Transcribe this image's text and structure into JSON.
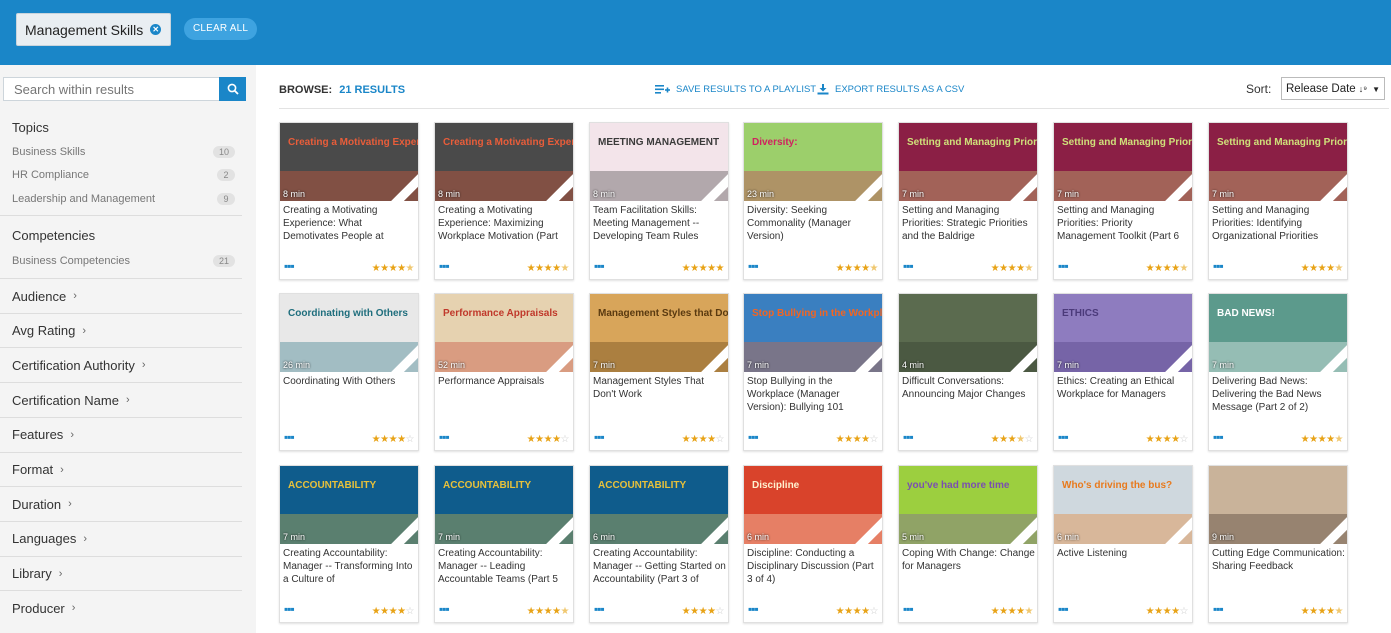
{
  "filter_chip": {
    "label": "Management Skills"
  },
  "clear_all": "CLEAR ALL",
  "search": {
    "placeholder": "Search within results"
  },
  "topics": {
    "title": "Topics",
    "items": [
      {
        "label": "Business Skills",
        "count": "10"
      },
      {
        "label": "HR Compliance",
        "count": "2"
      },
      {
        "label": "Leadership and Management",
        "count": "9"
      }
    ]
  },
  "competencies": {
    "title": "Competencies",
    "items": [
      {
        "label": "Business Competencies",
        "count": "21"
      }
    ]
  },
  "facets": [
    "Audience",
    "Avg Rating",
    "Certification Authority",
    "Certification Name",
    "Features",
    "Format",
    "Duration",
    "Languages",
    "Library",
    "Producer"
  ],
  "toolbar": {
    "browse_label": "BROWSE:",
    "results": "21 RESULTS",
    "save_playlist": "SAVE RESULTS TO A PLAYLIST",
    "export_csv": "EXPORT RESULTS AS A CSV",
    "sort_label": "Sort:",
    "sort_value": "Release Date"
  },
  "colors": {
    "brand": "#1a86c8",
    "star": "#e8a317"
  },
  "cards": [
    {
      "title": "Creating a Motivating Experience: What Demotivates People at",
      "duration": "8 min",
      "rating": 4.5,
      "thumb": {
        "bg": "#4a4a4a",
        "text": "Creating a Motivating Experience",
        "accent": "#e85d3a"
      }
    },
    {
      "title": "Creating a Motivating Experience: Maximizing Workplace Motivation (Part",
      "duration": "8 min",
      "rating": 4.5,
      "thumb": {
        "bg": "#4a4a4a",
        "text": "Creating a Motivating Experience",
        "accent": "#e85d3a"
      }
    },
    {
      "title": "Team Facilitation Skills: Meeting Management -- Developing Team Rules",
      "duration": "8 min",
      "rating": 5,
      "thumb": {
        "bg": "#f3e4ea",
        "text": "MEETING MANAGEMENT",
        "accent": "#3a3a3a"
      }
    },
    {
      "title": "Diversity: Seeking Commonality (Manager Version)",
      "duration": "23 min",
      "rating": 4.5,
      "thumb": {
        "bg": "#9ccf6b",
        "text": "Diversity:",
        "accent": "#d0215f"
      }
    },
    {
      "title": "Setting and Managing Priorities: Strategic Priorities and the Baldrige",
      "duration": "7 min",
      "rating": 4.5,
      "thumb": {
        "bg": "#8b1f45",
        "text": "Setting and Managing Priorities",
        "accent": "#cfe07a"
      }
    },
    {
      "title": "Setting and Managing Priorities: Priority Management Toolkit (Part 6",
      "duration": "7 min",
      "rating": 4.5,
      "thumb": {
        "bg": "#8b1f45",
        "text": "Setting and Managing Priorities",
        "accent": "#cfe07a"
      }
    },
    {
      "title": "Setting and Managing Priorities: Identifying Organizational Priorities",
      "duration": "7 min",
      "rating": 4.5,
      "thumb": {
        "bg": "#8b1f45",
        "text": "Setting and Managing Priorities",
        "accent": "#cfe07a"
      }
    },
    {
      "title": "Coordinating With Others",
      "duration": "26 min",
      "rating": 4,
      "thumb": {
        "bg": "#e8e8e8",
        "text": "Coordinating with Others",
        "accent": "#1f6e7d"
      }
    },
    {
      "title": "Performance Appraisals",
      "duration": "52 min",
      "rating": 4,
      "thumb": {
        "bg": "#e6d2b0",
        "text": "Performance Appraisals",
        "accent": "#c0392b"
      }
    },
    {
      "title": "Management Styles That Don't Work",
      "duration": "7 min",
      "rating": 4,
      "thumb": {
        "bg": "#d8a55a",
        "text": "Management Styles that Don't Work",
        "accent": "#5a3a10"
      }
    },
    {
      "title": "Stop Bullying in the Workplace (Manager Version): Bullying 101",
      "duration": "7 min",
      "rating": 4,
      "thumb": {
        "bg": "#3a7fc0",
        "text": "Stop Bullying in the Workplace",
        "accent": "#f26522"
      }
    },
    {
      "title": "Difficult Conversations: Announcing Major Changes",
      "duration": "4 min",
      "rating": 3.5,
      "thumb": {
        "bg": "#5b6b4f",
        "text": "",
        "accent": "#2e3a2a"
      }
    },
    {
      "title": "Ethics: Creating an Ethical Workplace for Managers",
      "duration": "7 min",
      "rating": 4,
      "thumb": {
        "bg": "#8e7cbf",
        "text": "ETHICS",
        "accent": "#4b3a7a"
      }
    },
    {
      "title": "Delivering Bad News: Delivering the Bad News Message (Part 2 of 2)",
      "duration": "7 min",
      "rating": 4.5,
      "thumb": {
        "bg": "#5c9a8c",
        "text": "BAD NEWS!",
        "accent": "#ffffff"
      }
    },
    {
      "title": "Creating Accountability: Manager -- Transforming Into a Culture of",
      "duration": "7 min",
      "rating": 4,
      "thumb": {
        "bg": "#0f5c8c",
        "text": "ACCOUNTABILITY",
        "accent": "#e8c13a"
      }
    },
    {
      "title": "Creating Accountability: Manager -- Leading Accountable Teams (Part 5",
      "duration": "7 min",
      "rating": 4.5,
      "thumb": {
        "bg": "#0f5c8c",
        "text": "ACCOUNTABILITY",
        "accent": "#e8c13a"
      }
    },
    {
      "title": "Creating Accountability: Manager -- Getting Started on Accountability (Part 3 of",
      "duration": "6 min",
      "rating": 4,
      "thumb": {
        "bg": "#0f5c8c",
        "text": "ACCOUNTABILITY",
        "accent": "#e8c13a"
      }
    },
    {
      "title": "Discipline: Conducting a Disciplinary Discussion (Part 3 of 4)",
      "duration": "6 min",
      "rating": 4,
      "thumb": {
        "bg": "#d9432b",
        "text": "Discipline",
        "accent": "#fff2d0"
      }
    },
    {
      "title": "Coping With Change: Change for Managers",
      "duration": "5 min",
      "rating": 4.5,
      "thumb": {
        "bg": "#9ccf3f",
        "text": "you've had more time",
        "accent": "#7a4fb0"
      }
    },
    {
      "title": "Active Listening",
      "duration": "6 min",
      "rating": 4,
      "thumb": {
        "bg": "#cfd8de",
        "text": "Who's driving the bus?",
        "accent": "#e87a1d"
      }
    },
    {
      "title": "Cutting Edge Communication: Sharing Feedback",
      "duration": "9 min",
      "rating": 4.5,
      "thumb": {
        "bg": "#c9b39a",
        "text": "",
        "accent": "#3a2a22"
      }
    }
  ]
}
